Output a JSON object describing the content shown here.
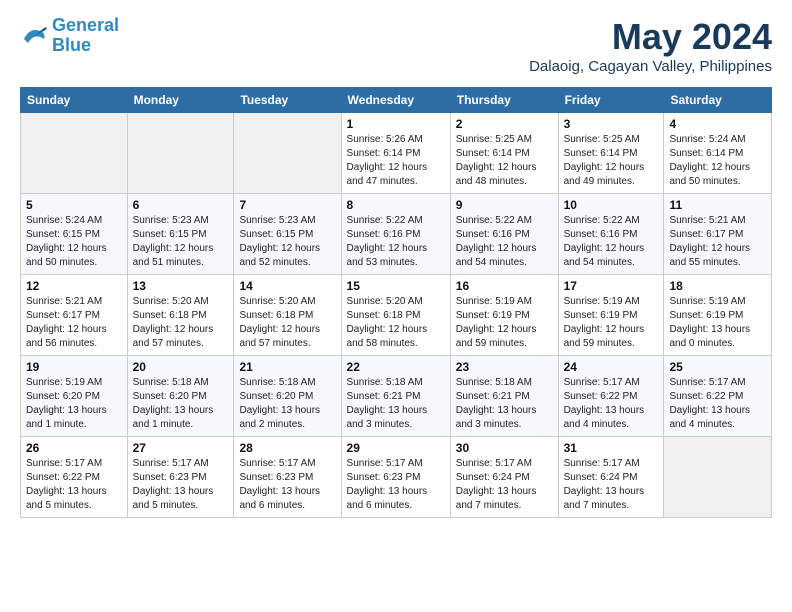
{
  "header": {
    "logo_line1": "General",
    "logo_line2": "Blue",
    "month": "May 2024",
    "location": "Dalaoig, Cagayan Valley, Philippines"
  },
  "weekdays": [
    "Sunday",
    "Monday",
    "Tuesday",
    "Wednesday",
    "Thursday",
    "Friday",
    "Saturday"
  ],
  "weeks": [
    [
      {
        "day": "",
        "empty": true
      },
      {
        "day": "",
        "empty": true
      },
      {
        "day": "",
        "empty": true
      },
      {
        "day": "1",
        "rise": "5:26 AM",
        "set": "6:14 PM",
        "daylight": "12 hours and 47 minutes."
      },
      {
        "day": "2",
        "rise": "5:25 AM",
        "set": "6:14 PM",
        "daylight": "12 hours and 48 minutes."
      },
      {
        "day": "3",
        "rise": "5:25 AM",
        "set": "6:14 PM",
        "daylight": "12 hours and 49 minutes."
      },
      {
        "day": "4",
        "rise": "5:24 AM",
        "set": "6:14 PM",
        "daylight": "12 hours and 50 minutes."
      }
    ],
    [
      {
        "day": "5",
        "rise": "5:24 AM",
        "set": "6:15 PM",
        "daylight": "12 hours and 50 minutes."
      },
      {
        "day": "6",
        "rise": "5:23 AM",
        "set": "6:15 PM",
        "daylight": "12 hours and 51 minutes."
      },
      {
        "day": "7",
        "rise": "5:23 AM",
        "set": "6:15 PM",
        "daylight": "12 hours and 52 minutes."
      },
      {
        "day": "8",
        "rise": "5:22 AM",
        "set": "6:16 PM",
        "daylight": "12 hours and 53 minutes."
      },
      {
        "day": "9",
        "rise": "5:22 AM",
        "set": "6:16 PM",
        "daylight": "12 hours and 54 minutes."
      },
      {
        "day": "10",
        "rise": "5:22 AM",
        "set": "6:16 PM",
        "daylight": "12 hours and 54 minutes."
      },
      {
        "day": "11",
        "rise": "5:21 AM",
        "set": "6:17 PM",
        "daylight": "12 hours and 55 minutes."
      }
    ],
    [
      {
        "day": "12",
        "rise": "5:21 AM",
        "set": "6:17 PM",
        "daylight": "12 hours and 56 minutes."
      },
      {
        "day": "13",
        "rise": "5:20 AM",
        "set": "6:18 PM",
        "daylight": "12 hours and 57 minutes."
      },
      {
        "day": "14",
        "rise": "5:20 AM",
        "set": "6:18 PM",
        "daylight": "12 hours and 57 minutes."
      },
      {
        "day": "15",
        "rise": "5:20 AM",
        "set": "6:18 PM",
        "daylight": "12 hours and 58 minutes."
      },
      {
        "day": "16",
        "rise": "5:19 AM",
        "set": "6:19 PM",
        "daylight": "12 hours and 59 minutes."
      },
      {
        "day": "17",
        "rise": "5:19 AM",
        "set": "6:19 PM",
        "daylight": "12 hours and 59 minutes."
      },
      {
        "day": "18",
        "rise": "5:19 AM",
        "set": "6:19 PM",
        "daylight": "13 hours and 0 minutes."
      }
    ],
    [
      {
        "day": "19",
        "rise": "5:19 AM",
        "set": "6:20 PM",
        "daylight": "13 hours and 1 minute."
      },
      {
        "day": "20",
        "rise": "5:18 AM",
        "set": "6:20 PM",
        "daylight": "13 hours and 1 minute."
      },
      {
        "day": "21",
        "rise": "5:18 AM",
        "set": "6:20 PM",
        "daylight": "13 hours and 2 minutes."
      },
      {
        "day": "22",
        "rise": "5:18 AM",
        "set": "6:21 PM",
        "daylight": "13 hours and 3 minutes."
      },
      {
        "day": "23",
        "rise": "5:18 AM",
        "set": "6:21 PM",
        "daylight": "13 hours and 3 minutes."
      },
      {
        "day": "24",
        "rise": "5:17 AM",
        "set": "6:22 PM",
        "daylight": "13 hours and 4 minutes."
      },
      {
        "day": "25",
        "rise": "5:17 AM",
        "set": "6:22 PM",
        "daylight": "13 hours and 4 minutes."
      }
    ],
    [
      {
        "day": "26",
        "rise": "5:17 AM",
        "set": "6:22 PM",
        "daylight": "13 hours and 5 minutes."
      },
      {
        "day": "27",
        "rise": "5:17 AM",
        "set": "6:23 PM",
        "daylight": "13 hours and 5 minutes."
      },
      {
        "day": "28",
        "rise": "5:17 AM",
        "set": "6:23 PM",
        "daylight": "13 hours and 6 minutes."
      },
      {
        "day": "29",
        "rise": "5:17 AM",
        "set": "6:23 PM",
        "daylight": "13 hours and 6 minutes."
      },
      {
        "day": "30",
        "rise": "5:17 AM",
        "set": "6:24 PM",
        "daylight": "13 hours and 7 minutes."
      },
      {
        "day": "31",
        "rise": "5:17 AM",
        "set": "6:24 PM",
        "daylight": "13 hours and 7 minutes."
      },
      {
        "day": "",
        "empty": true
      }
    ]
  ]
}
